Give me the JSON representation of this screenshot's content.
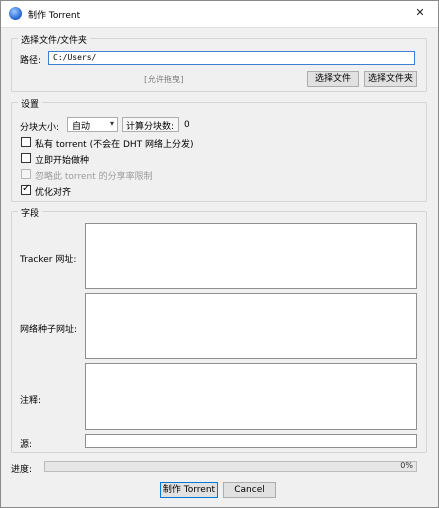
{
  "window": {
    "title": "制作 Torrent",
    "icon": "app-globe-icon",
    "close_glyph": "✕"
  },
  "source": {
    "legend": "选择文件/文件夹",
    "path_label": "路径:",
    "path_value": "C:/Users/",
    "drop_hint": "[允许拖曳]",
    "select_file_button": "选择文件",
    "select_folder_button": "选择文件夹"
  },
  "settings": {
    "legend": "设置",
    "piece_size_label": "分块大小:",
    "piece_size_value": "自动",
    "calc_pieces_label": "计算分块数:",
    "calc_pieces_value": "0",
    "private_label": "私有 torrent  (不会在 DHT 网络上分发)",
    "private_checked": false,
    "start_seeding_label": "立即开始做种",
    "start_seeding_checked": false,
    "ignore_ratio_label": "忽略此 torrent 的分享率限制",
    "ignore_ratio_checked": false,
    "ignore_ratio_disabled": true,
    "optimize_label": "优化对齐",
    "optimize_checked": true,
    "check_glyph": "✓"
  },
  "fields": {
    "legend": "字段",
    "tracker_label": "Tracker 网址:",
    "webseed_label": "网络种子网址:",
    "comment_label": "注释:",
    "source_label": "源:"
  },
  "footer": {
    "progress_label": "进度:",
    "progress_value": "0%",
    "progress_fraction": 0,
    "create_button": "制作 Torrent",
    "cancel_button": "Cancel"
  }
}
